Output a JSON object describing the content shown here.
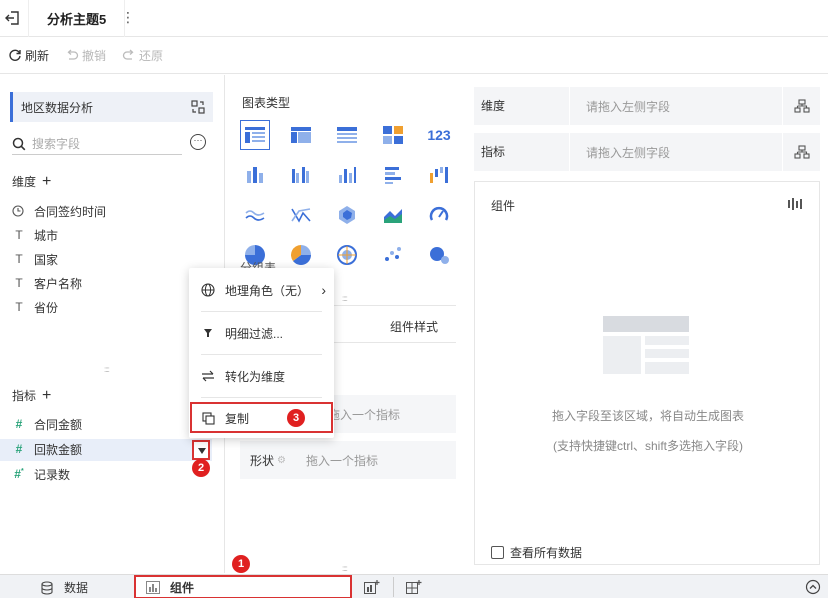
{
  "topbar": {
    "title": "分析主题5",
    "more": "⋮"
  },
  "toolbar": {
    "refresh": "刷新",
    "undo": "撤销",
    "redo": "还原"
  },
  "left": {
    "dataset": "地区数据分析",
    "search_placeholder": "搜索字段",
    "more": "···",
    "dim_title": "维度",
    "dimensions": [
      {
        "label": "合同签约时间",
        "icon": "clock-icon"
      },
      {
        "label": "城市",
        "icon": "text-type-icon"
      },
      {
        "label": "国家",
        "icon": "text-type-icon"
      },
      {
        "label": "客户名称",
        "icon": "text-type-icon"
      },
      {
        "label": "省份",
        "icon": "text-type-icon"
      }
    ],
    "metric_title": "指标",
    "metrics": [
      {
        "label": "合同金额",
        "icon": "number-type-icon"
      },
      {
        "label": "回款金额",
        "icon": "number-type-icon"
      },
      {
        "label": "记录数",
        "icon": "number-type-icon"
      }
    ]
  },
  "middle": {
    "chart_type_title": "图表类型",
    "partial_label": "分组表",
    "tab_style": "组件样式",
    "metric_drop_placeholder": "拖入一个指标",
    "shape_label": "形状",
    "shape_placeholder": "拖入一个指标"
  },
  "right": {
    "dim_label": "维度",
    "dim_placeholder": "请拖入左侧字段",
    "metric_label": "指标",
    "metric_placeholder": "请拖入左侧字段",
    "component_title": "组件",
    "hint1": "拖入字段至该区域，将自动生成图表",
    "hint2": "(支持快捷键ctrl、shift多选拖入字段)",
    "view_all": "查看所有数据"
  },
  "context_menu": {
    "geo_role": "地理角色（无）",
    "detail_filter": "明细过滤...",
    "to_dimension": "转化为维度",
    "copy": "复制"
  },
  "bottom": {
    "data_tab": "数据",
    "component_tab": "组件"
  },
  "badges": {
    "b1": "1",
    "b2": "2",
    "b3": "3"
  },
  "colors": {
    "accent": "#3b6fd8",
    "highlight": "#d93232",
    "badge": "#e02020"
  }
}
